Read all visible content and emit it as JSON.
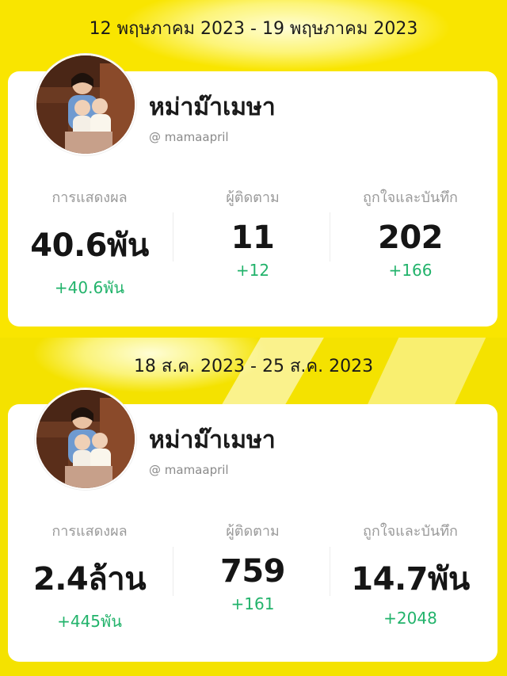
{
  "periods": [
    {
      "date_range": "12 พฤษภาคม 2023 - 19 พฤษภาคม 2023",
      "profile": {
        "name": "หม่าม๊าเมษา",
        "handle": "@ mamaapril"
      },
      "stats": [
        {
          "label": "การแสดงผล",
          "value": "40.6พัน",
          "delta": "+40.6พัน"
        },
        {
          "label": "ผู้ติดตาม",
          "value": "11",
          "delta": "+12"
        },
        {
          "label": "ถูกใจและบันทึก",
          "value": "202",
          "delta": "+166"
        }
      ]
    },
    {
      "date_range": "18 ส.ค. 2023 - 25 ส.ค. 2023",
      "profile": {
        "name": "หม่าม๊าเมษา",
        "handle": "@ mamaapril"
      },
      "stats": [
        {
          "label": "การแสดงผล",
          "value": "2.4ล้าน",
          "delta": "+445พัน"
        },
        {
          "label": "ผู้ติดตาม",
          "value": "759",
          "delta": "+161"
        },
        {
          "label": "ถูกใจและบันทึก",
          "value": "14.7พัน",
          "delta": "+2048"
        }
      ]
    }
  ],
  "colors": {
    "background": "#f9e500",
    "card": "#ffffff",
    "delta_green": "#22b36b",
    "label_gray": "#9a9a9a"
  }
}
